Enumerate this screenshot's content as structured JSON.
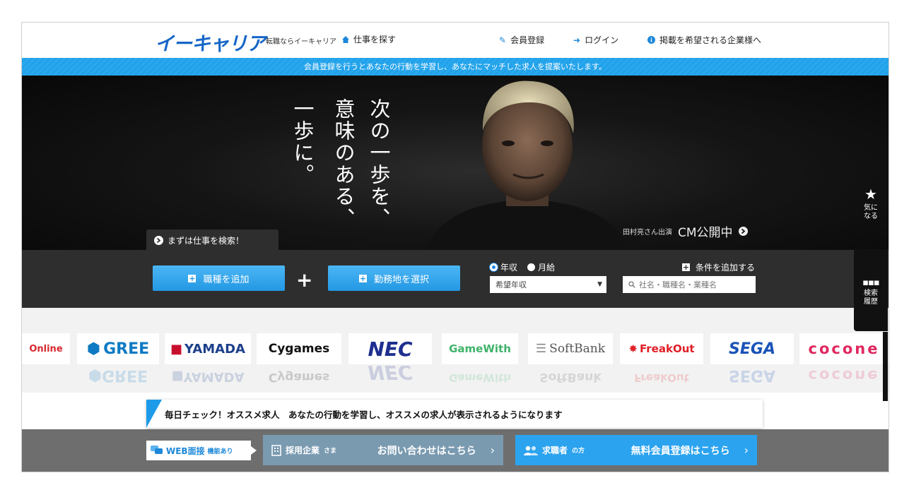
{
  "header": {
    "logo": "イーキャリア",
    "tagline": "転職ならイーキャリア",
    "job_search": "仕事を探す",
    "nav": [
      {
        "label": "会員登録",
        "icon": "edit-icon"
      },
      {
        "label": "ログイン",
        "icon": "login-icon"
      },
      {
        "label": "掲載を希望される企業様へ",
        "icon": "info-icon"
      }
    ]
  },
  "banner_text": "会員登録を行うとあなたの行動を学習し、あなたにマッチした求人を提案いたします。",
  "hero": {
    "copy_lines": [
      "次の一歩を、",
      "意味のある、",
      "一歩に。"
    ],
    "cm_small": "田村亮さん出演",
    "cm_big": "CM公開中"
  },
  "search": {
    "tab_label": "まずは仕事を検索！",
    "job_type_button": "職種を追加",
    "location_button": "勤務地を選択",
    "salary_options": [
      "年収",
      "月給"
    ],
    "salary_selected": "年収",
    "salary_select": "希望年収",
    "add_condition": "条件を追加する",
    "keyword_placeholder": "社名・職種名・業種名"
  },
  "logos": [
    {
      "name": "Online",
      "color": "#d7282f"
    },
    {
      "name": "GREE",
      "color": "#0e7ac4"
    },
    {
      "name": "YAMADA",
      "color": "#1b3f8b"
    },
    {
      "name": "Cygames",
      "color": "#111111"
    },
    {
      "name": "NEC",
      "color": "#1e2f8f"
    },
    {
      "name": "GameWith",
      "color": "#3fb36a"
    },
    {
      "name": "SoftBank",
      "color": "#555555"
    },
    {
      "name": "FreakOut",
      "color": "#e01f26"
    },
    {
      "name": "SEGA",
      "color": "#1b53b8"
    },
    {
      "name": "cocone",
      "color": "#e0285e"
    }
  ],
  "recommend_text": "毎日チェック！オススメ求人　あなたの行動を学習し、オススメの求人が表示されるようになります",
  "bottom": {
    "web_interview": "WEB面接",
    "web_interview_sub": "機能あり",
    "corp_label": "採用企業",
    "corp_sub": "さま",
    "corp_cta": "お問い合わせはこちら",
    "seeker_label": "求職者",
    "seeker_sub": "の方",
    "seeker_cta": "無料会員登録はこちら"
  },
  "side": {
    "favorite": "気になる",
    "history": "検索履歴"
  },
  "colors": {
    "brand": "#1767c7",
    "accent": "#2ba3ef"
  }
}
